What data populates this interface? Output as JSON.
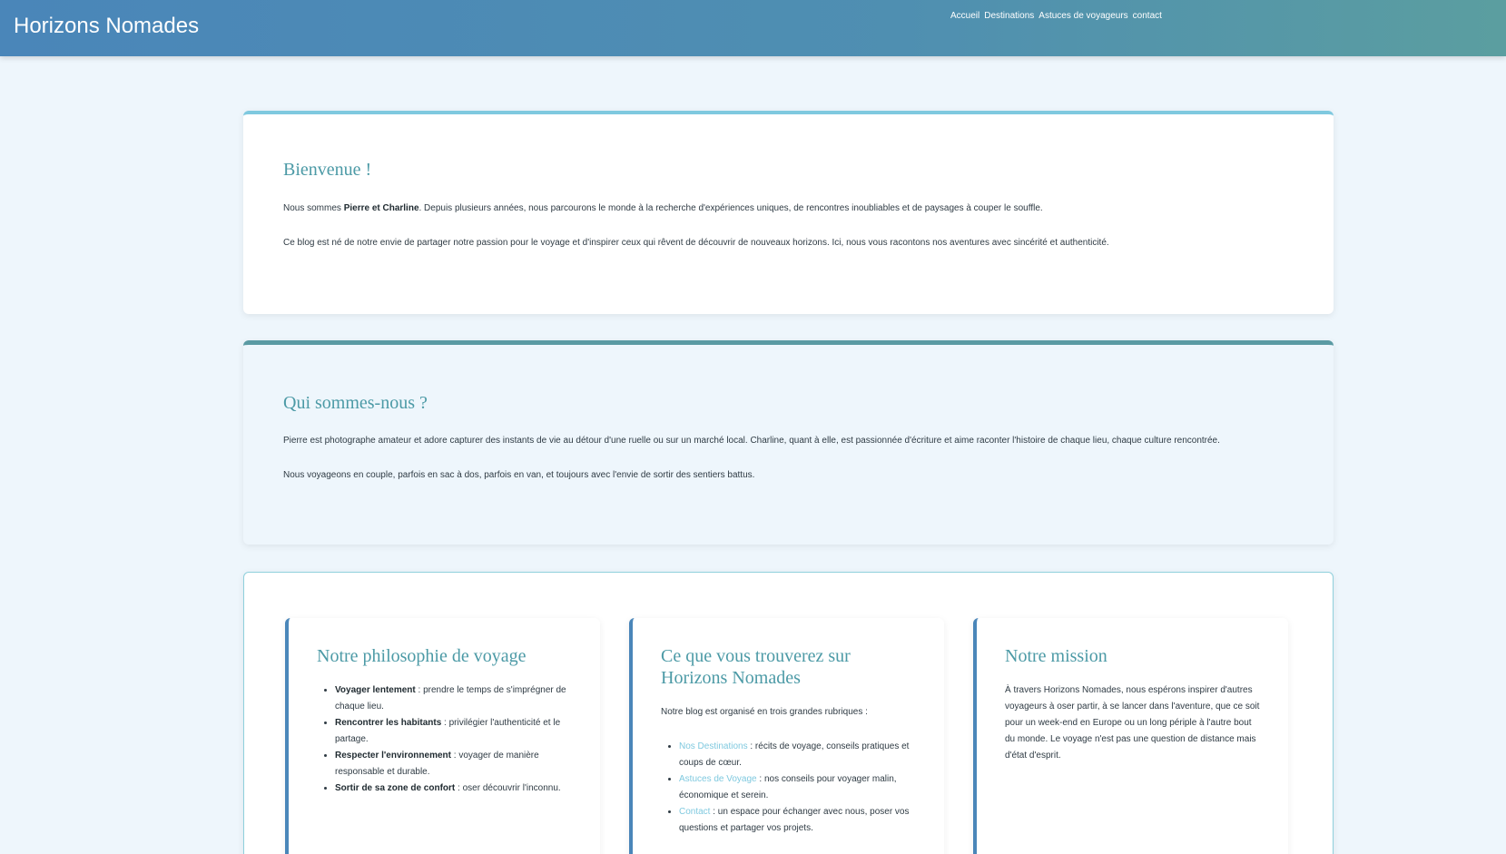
{
  "header": {
    "title": "Horizons Nomades",
    "nav": [
      "Accueil",
      "Destinations",
      "Astuces de voyageurs",
      "contact"
    ]
  },
  "welcome": {
    "title": "Bienvenue !",
    "p1_before": "Nous sommes ",
    "p1_bold": "Pierre et Charline",
    "p1_after": ". Depuis plusieurs années, nous parcourons le monde à la recherche d'expériences uniques, de rencontres inoubliables et de paysages à couper le souffle.",
    "p2": "Ce blog est né de notre envie de partager notre passion pour le voyage et d'inspirer ceux qui rêvent de découvrir de nouveaux horizons. Ici, nous vous racontons nos aventures avec sincérité et authenticité."
  },
  "about": {
    "title": "Qui sommes-nous ?",
    "p1": "Pierre est photographe amateur et adore capturer des instants de vie au détour d'une ruelle ou sur un marché local. Charline, quant à elle, est passionnée d'écriture et aime raconter l'histoire de chaque lieu, chaque culture rencontrée.",
    "p2": "Nous voyageons en couple, parfois en sac à dos, parfois en van, et toujours avec l'envie de sortir des sentiers battus."
  },
  "philosophy": {
    "title": "Notre philosophie de voyage",
    "items": [
      {
        "bold": "Voyager lentement",
        "text": " : prendre le temps de s'imprégner de chaque lieu."
      },
      {
        "bold": "Rencontrer les habitants",
        "text": " : privilégier l'authenticité et le partage."
      },
      {
        "bold": "Respecter l'environnement",
        "text": " : voyager de manière responsable et durable."
      },
      {
        "bold": "Sortir de sa zone de confort",
        "text": " : oser découvrir l'inconnu."
      }
    ]
  },
  "content": {
    "title": "Ce que vous trouverez sur Horizons Nomades",
    "intro": "Notre blog est organisé en trois grandes rubriques :",
    "items": [
      {
        "link": "Nos Destinations",
        "text": " : récits de voyage, conseils pratiques et coups de cœur."
      },
      {
        "link": "Astuces de Voyage",
        "text": " : nos conseils pour voyager malin, économique et serein."
      },
      {
        "link": "Contact",
        "text": " : un espace pour échanger avec nous, poser vos questions et partager vos projets."
      }
    ]
  },
  "mission": {
    "title": "Notre mission",
    "text": "À travers Horizons Nomades, nous espérons inspirer d'autres voyageurs à oser partir, à se lancer dans l'aventure, que ce soit pour un week-end en Europe ou un long périple à l'autre bout du monde. Le voyage n'est pas une question de distance mais d'état d'esprit."
  },
  "colors": {
    "header_start": "#4a86b9",
    "header_end": "#5b9ea0",
    "heading": "#4c9aa6",
    "link": "#7fc9df",
    "background": "#eef6fc"
  }
}
